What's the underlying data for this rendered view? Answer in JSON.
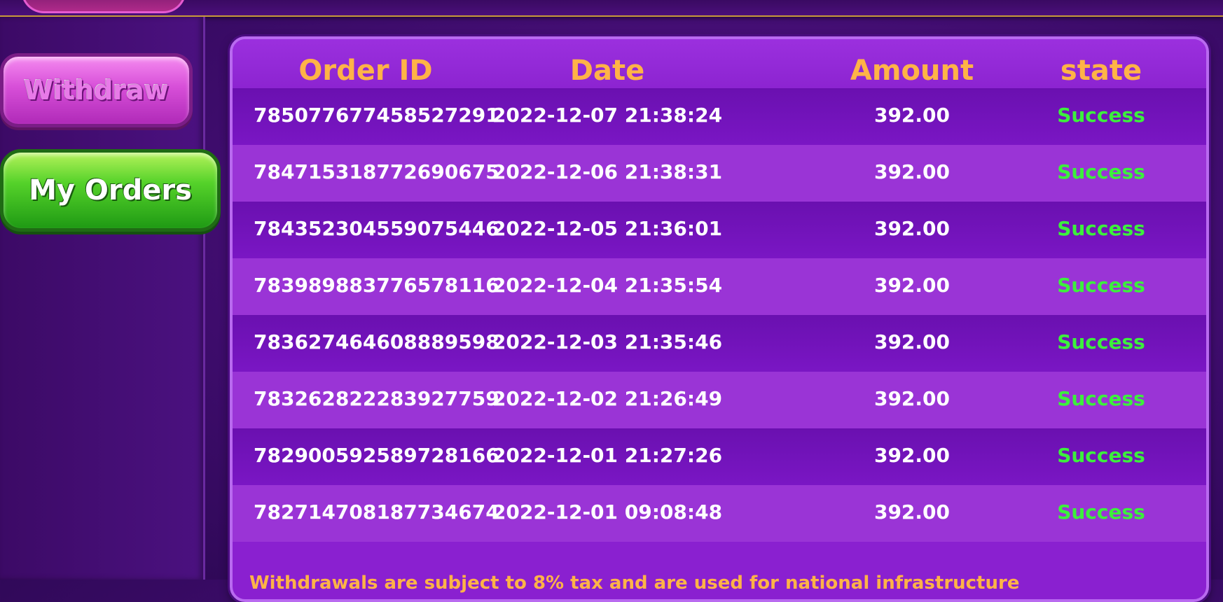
{
  "sidebar": {
    "withdraw_label": "Withdraw",
    "my_orders_label": "My Orders"
  },
  "table": {
    "headers": {
      "order_id": "Order ID",
      "date": "Date",
      "amount": "Amount",
      "state": "state"
    },
    "rows": [
      {
        "order_id": "785077677458527291",
        "date": "2022-12-07 21:38:24",
        "amount": "392.00",
        "state": "Success"
      },
      {
        "order_id": "784715318772690675",
        "date": "2022-12-06 21:38:31",
        "amount": "392.00",
        "state": "Success"
      },
      {
        "order_id": "784352304559075446",
        "date": "2022-12-05 21:36:01",
        "amount": "392.00",
        "state": "Success"
      },
      {
        "order_id": "783989883776578116",
        "date": "2022-12-04 21:35:54",
        "amount": "392.00",
        "state": "Success"
      },
      {
        "order_id": "783627464608889598",
        "date": "2022-12-03 21:35:46",
        "amount": "392.00",
        "state": "Success"
      },
      {
        "order_id": "783262822283927759",
        "date": "2022-12-02 21:26:49",
        "amount": "392.00",
        "state": "Success"
      },
      {
        "order_id": "782900592589728166",
        "date": "2022-12-01 21:27:26",
        "amount": "392.00",
        "state": "Success"
      },
      {
        "order_id": "782714708187734674",
        "date": "2022-12-01 09:08:48",
        "amount": "392.00",
        "state": "Success"
      }
    ]
  },
  "notice": "Withdrawals are subject to 8% tax and are used for national infrastructure",
  "colors": {
    "header_text": "#ffb347",
    "success": "#3cf03c",
    "panel": "#8a20d0"
  }
}
